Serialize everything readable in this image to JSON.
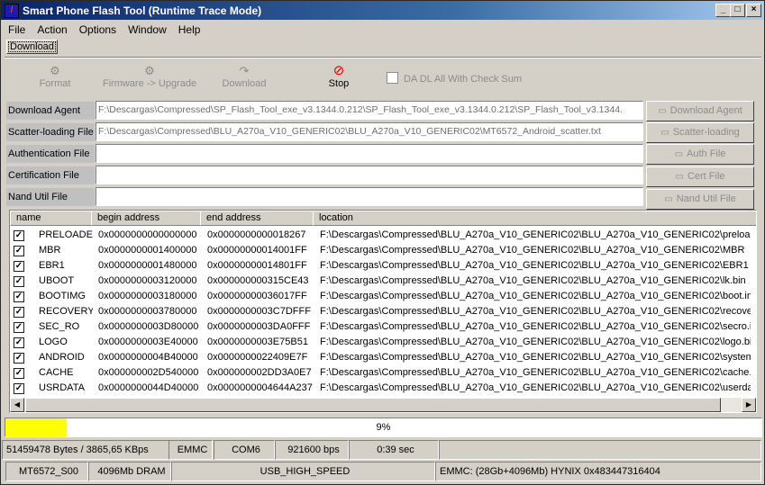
{
  "window": {
    "title": "Smart Phone Flash Tool (Runtime Trace Mode)"
  },
  "menu": [
    "File",
    "Action",
    "Options",
    "Window",
    "Help"
  ],
  "tab": "Download",
  "toolbar": {
    "format": "Format",
    "firmware_upgrade": "Firmware -> Upgrade",
    "download": "Download",
    "stop": "Stop",
    "da_checksum": "DA DL All With Check Sum"
  },
  "fields": {
    "download_agent": {
      "label": "Download Agent",
      "value": "F:\\Descargas\\Compressed\\SP_Flash_Tool_exe_v3.1344.0.212\\SP_Flash_Tool_exe_v3.1344.0.212\\SP_Flash_Tool_v3.1344.",
      "button": "Download Agent"
    },
    "scatter": {
      "label": "Scatter-loading File",
      "value": "F:\\Descargas\\Compressed\\BLU_A270a_V10_GENERIC02\\BLU_A270a_V10_GENERIC02\\MT6572_Android_scatter.txt",
      "button": "Scatter-loading"
    },
    "auth": {
      "label": "Authentication File",
      "value": "",
      "button": "Auth File"
    },
    "cert": {
      "label": "Certification File",
      "value": "",
      "button": "Cert File"
    },
    "nand": {
      "label": "Nand Util File",
      "value": "",
      "button": "Nand Util File"
    }
  },
  "table": {
    "columns": [
      "name",
      "begin address",
      "end address",
      "location"
    ],
    "rows": [
      {
        "checked": true,
        "name": "PRELOADER",
        "begin": "0x0000000000000000",
        "end": "0x0000000000018267",
        "location": "F:\\Descargas\\Compressed\\BLU_A270a_V10_GENERIC02\\BLU_A270a_V10_GENERIC02\\preloader_"
      },
      {
        "checked": true,
        "name": "MBR",
        "begin": "0x0000000001400000",
        "end": "0x00000000014001FF",
        "location": "F:\\Descargas\\Compressed\\BLU_A270a_V10_GENERIC02\\BLU_A270a_V10_GENERIC02\\MBR"
      },
      {
        "checked": true,
        "name": "EBR1",
        "begin": "0x0000000001480000",
        "end": "0x00000000014801FF",
        "location": "F:\\Descargas\\Compressed\\BLU_A270a_V10_GENERIC02\\BLU_A270a_V10_GENERIC02\\EBR1"
      },
      {
        "checked": true,
        "name": "UBOOT",
        "begin": "0x0000000003120000",
        "end": "0x000000000315CE43",
        "location": "F:\\Descargas\\Compressed\\BLU_A270a_V10_GENERIC02\\BLU_A270a_V10_GENERIC02\\lk.bin"
      },
      {
        "checked": true,
        "name": "BOOTIMG",
        "begin": "0x0000000003180000",
        "end": "0x00000000036017FF",
        "location": "F:\\Descargas\\Compressed\\BLU_A270a_V10_GENERIC02\\BLU_A270a_V10_GENERIC02\\boot.img"
      },
      {
        "checked": true,
        "name": "RECOVERY",
        "begin": "0x0000000003780000",
        "end": "0x0000000003C7DFFF",
        "location": "F:\\Descargas\\Compressed\\BLU_A270a_V10_GENERIC02\\BLU_A270a_V10_GENERIC02\\recovery."
      },
      {
        "checked": true,
        "name": "SEC_RO",
        "begin": "0x0000000003D80000",
        "end": "0x0000000003DA0FFF",
        "location": "F:\\Descargas\\Compressed\\BLU_A270a_V10_GENERIC02\\BLU_A270a_V10_GENERIC02\\secro.img"
      },
      {
        "checked": true,
        "name": "LOGO",
        "begin": "0x0000000003E40000",
        "end": "0x0000000003E75B51",
        "location": "F:\\Descargas\\Compressed\\BLU_A270a_V10_GENERIC02\\BLU_A270a_V10_GENERIC02\\logo.bin"
      },
      {
        "checked": true,
        "name": "ANDROID",
        "begin": "0x0000000004B40000",
        "end": "0x0000000022409E7F",
        "location": "F:\\Descargas\\Compressed\\BLU_A270a_V10_GENERIC02\\BLU_A270a_V10_GENERIC02\\system.im"
      },
      {
        "checked": true,
        "name": "CACHE",
        "begin": "0x000000002D540000",
        "end": "0x000000002DD3A0E7",
        "location": "F:\\Descargas\\Compressed\\BLU_A270a_V10_GENERIC02\\BLU_A270a_V10_GENERIC02\\cache.im"
      },
      {
        "checked": true,
        "name": "USRDATA",
        "begin": "0x0000000044D40000",
        "end": "0x0000000004644A237",
        "location": "F:\\Descargas\\Compressed\\BLU_A270a_V10_GENERIC02\\BLU_A270a_V10_GENERIC02\\userdata."
      }
    ]
  },
  "progress": {
    "percent_text": "9%",
    "fraction": 0.09,
    "color": "#ffff00"
  },
  "status": {
    "bytes_speed": "51459478 Bytes / 3865,65 KBps",
    "storage": "EMMC",
    "port": "COM6",
    "baud": "921600 bps",
    "time": "0:39 sec",
    "chip": "MT6572_S00",
    "dram": "4096Mb DRAM",
    "usb": "USB_HIGH_SPEED",
    "emmc_info": "EMMC: (28Gb+4096Mb) HYNIX 0x483447316404"
  }
}
